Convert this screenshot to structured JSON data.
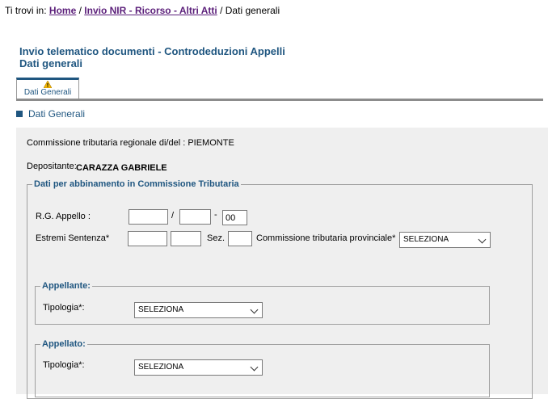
{
  "breadcrumb": {
    "prefix": "Ti trovi in:",
    "home": "Home",
    "sep1": "/",
    "section": "Invio NIR - Ricorso - Altri Atti",
    "sep2": "/",
    "current": "Dati generali"
  },
  "page": {
    "title_line1": "Invio telematico documenti - Controdeduzioni Appelli",
    "title_line2": "Dati generali"
  },
  "tabs": [
    {
      "label": "Dati Generali",
      "icon": "warning-icon"
    }
  ],
  "section_title": "Dati Generali",
  "commissione": {
    "label": "Commissione tributaria regionale di/del :",
    "value": "PIEMONTE"
  },
  "depositante": {
    "label": "Depositante:",
    "value": "CARAZZA GABRIELE"
  },
  "abbinamento": {
    "legend": "Dati per abbinamento in Commissione Tributaria",
    "rg_label": "R.G. Appello :",
    "rg_sep1": "/",
    "rg_sep2": "-",
    "rg_part1": "",
    "rg_part2": "",
    "rg_part3": "00",
    "estremi_label": "Estremi Sentenza*",
    "estremi_num": "",
    "estremi_anno": "",
    "sez_label": "Sez.",
    "sez_value": "",
    "comm_prov_label": "Commissione tributaria provinciale*",
    "comm_prov_selected": "SELEZIONA"
  },
  "appellante": {
    "legend": "Appellante:",
    "tipologia_label": "Tipologia*:",
    "tipologia_selected": "SELEZIONA"
  },
  "appellato": {
    "legend": "Appellato:",
    "tipologia_label": "Tipologia*:",
    "tipologia_selected": "SELEZIONA"
  },
  "colors": {
    "title_blue": "#1f5680",
    "link_purple": "#5b1f7a",
    "panel_bg": "#efefef",
    "warning": "#f2b705"
  }
}
